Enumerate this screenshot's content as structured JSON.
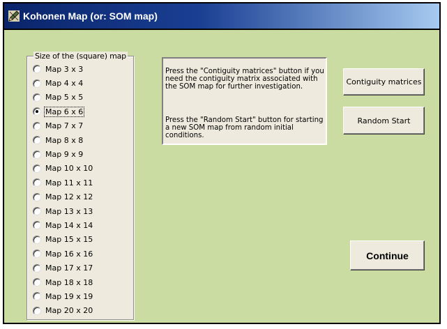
{
  "window": {
    "title": "Kohonen Map (or: SOM map)"
  },
  "map_size_group": {
    "title": "Size of the (square) map",
    "selected": "Map 6 x 6",
    "options": [
      "Map 3 x 3",
      "Map 4 x 4",
      "Map 5 x 5",
      "Map 6 x 6",
      "Map 7 x 7",
      "Map 8 x 8",
      "Map 9 x 9",
      "Map 10 x 10",
      "Map 11 x 11",
      "Map 12 x 12",
      "Map  13 x 13",
      "Map 14 x 14",
      "Map 15 x 15",
      "Map 16 x 16",
      "Map 17 x 17",
      "Map 18 x 18",
      "Map 19 x 19",
      "Map 20 x 20"
    ]
  },
  "info": {
    "paragraph1": "Press the \"Contiguity matrices\" button if you need the contiguity matrix associated with the SOM map for further investigation.",
    "paragraph2": "Press the \"Random Start\" button for starting a new SOM map from random initial conditions."
  },
  "buttons": {
    "contiguity": "Contiguity matrices",
    "random_start": "Random Start",
    "continue": "Continue"
  },
  "icons": {
    "app": "pencil-ruler-icon"
  },
  "colors": {
    "titlebar_start": "#0a246a",
    "titlebar_end": "#a6caf0",
    "client_background": "#cadca1",
    "control_face": "#eeebde"
  }
}
